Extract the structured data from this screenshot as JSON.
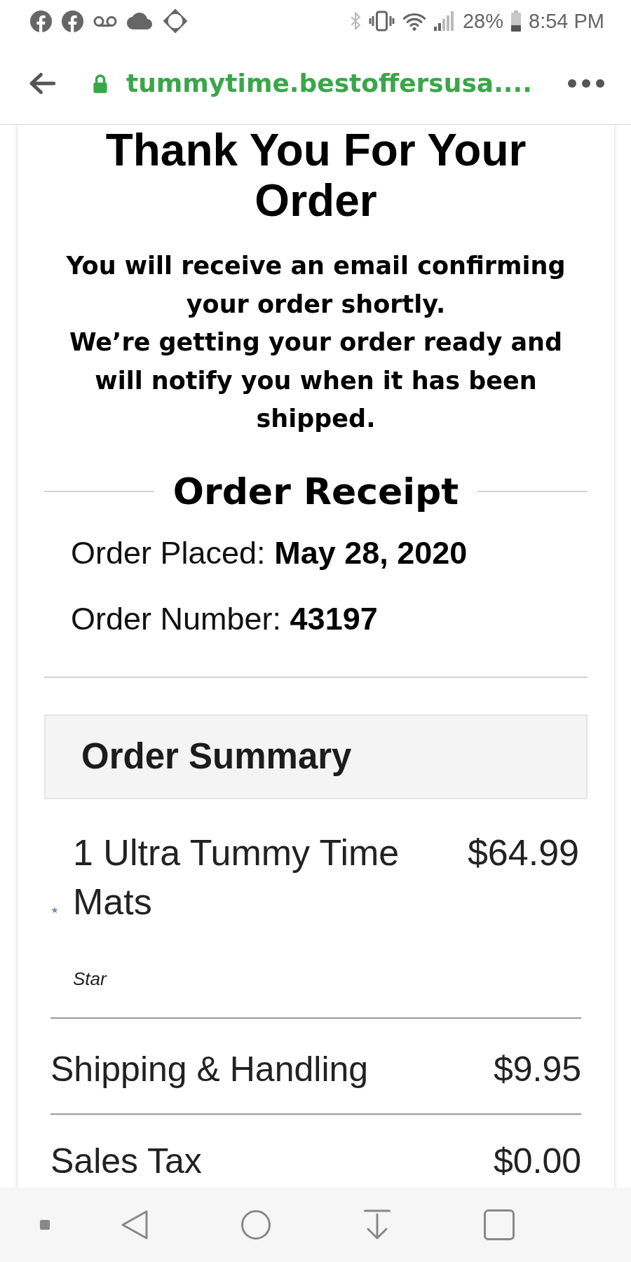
{
  "status_bar": {
    "battery": "28%",
    "time": "8:54 PM"
  },
  "address_bar": {
    "url": "tummytime.bestoffersusa...."
  },
  "confirmation": {
    "title": "Thank You For Your Order",
    "messages": [
      "You will receive an email confirming your order shortly.",
      "We’re getting your order ready and will notify you when it has been shipped."
    ]
  },
  "receipt": {
    "title": "Order Receipt",
    "details": [
      "Order Placed: **May 28, 2020**",
      "Order Number: **43197**"
    ]
  },
  "order_summary": {
    "title": "Order Summary",
    "items": [
      {
        "name": "1 Ultra Tummy Time Mats",
        "price": "$64.99",
        "note": "Star"
      }
    ],
    "totals": [
      {
        "label": "Shipping & Handling",
        "amount": "$9.95"
      },
      {
        "label": "Sales Tax",
        "amount": "$0.00"
      }
    ]
  }
}
